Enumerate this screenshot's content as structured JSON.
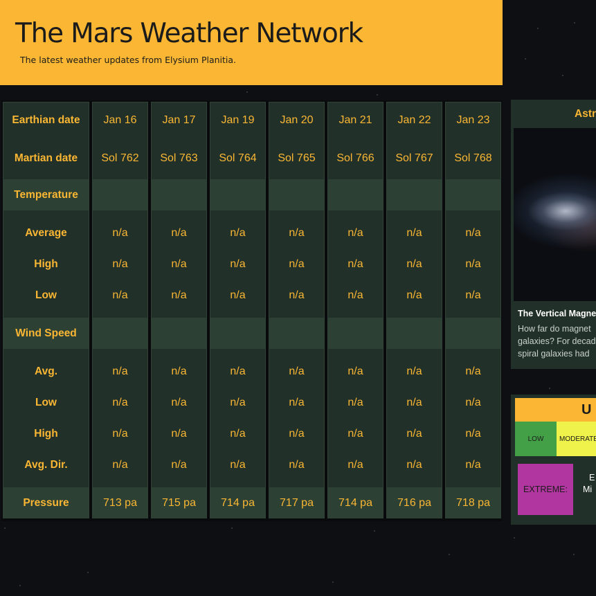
{
  "header": {
    "title": "The Mars Weather Network",
    "subtitle": "The latest weather updates from Elysium Planitia."
  },
  "weather": {
    "row_labels": {
      "earth_date": "Earthian date",
      "mars_date": "Martian date",
      "temperature": "Temperature",
      "temp_avg": "Average",
      "temp_high": "High",
      "temp_low": "Low",
      "wind_speed": "Wind Speed",
      "wind_avg": "Avg.",
      "wind_low": "Low",
      "wind_high": "High",
      "wind_dir": "Avg. Dir.",
      "pressure": "Pressure"
    },
    "days": [
      {
        "earth_date": "Jan 16",
        "mars_date": "Sol 762",
        "temp_avg": "n/a",
        "temp_high": "n/a",
        "temp_low": "n/a",
        "wind_avg": "n/a",
        "wind_low": "n/a",
        "wind_high": "n/a",
        "wind_dir": "n/a",
        "pressure": "713 pa"
      },
      {
        "earth_date": "Jan 17",
        "mars_date": "Sol 763",
        "temp_avg": "n/a",
        "temp_high": "n/a",
        "temp_low": "n/a",
        "wind_avg": "n/a",
        "wind_low": "n/a",
        "wind_high": "n/a",
        "wind_dir": "n/a",
        "pressure": "715 pa"
      },
      {
        "earth_date": "Jan 19",
        "mars_date": "Sol 764",
        "temp_avg": "n/a",
        "temp_high": "n/a",
        "temp_low": "n/a",
        "wind_avg": "n/a",
        "wind_low": "n/a",
        "wind_high": "n/a",
        "wind_dir": "n/a",
        "pressure": "714 pa"
      },
      {
        "earth_date": "Jan 20",
        "mars_date": "Sol 765",
        "temp_avg": "n/a",
        "temp_high": "n/a",
        "temp_low": "n/a",
        "wind_avg": "n/a",
        "wind_low": "n/a",
        "wind_high": "n/a",
        "wind_dir": "n/a",
        "pressure": "717 pa"
      },
      {
        "earth_date": "Jan 21",
        "mars_date": "Sol 766",
        "temp_avg": "n/a",
        "temp_high": "n/a",
        "temp_low": "n/a",
        "wind_avg": "n/a",
        "wind_low": "n/a",
        "wind_high": "n/a",
        "wind_dir": "n/a",
        "pressure": "714 pa"
      },
      {
        "earth_date": "Jan 22",
        "mars_date": "Sol 767",
        "temp_avg": "n/a",
        "temp_high": "n/a",
        "temp_low": "n/a",
        "wind_avg": "n/a",
        "wind_low": "n/a",
        "wind_high": "n/a",
        "wind_dir": "n/a",
        "pressure": "716 pa"
      },
      {
        "earth_date": "Jan 23",
        "mars_date": "Sol 768",
        "temp_avg": "n/a",
        "temp_high": "n/a",
        "temp_low": "n/a",
        "wind_avg": "n/a",
        "wind_low": "n/a",
        "wind_high": "n/a",
        "wind_dir": "n/a",
        "pressure": "718 pa"
      }
    ]
  },
  "apod": {
    "title": "Astro",
    "image_name": "galaxy-image",
    "caption": "The Vertical Magne",
    "text_lines": [
      "How far do magnet",
      "galaxies? For decad",
      "spiral galaxies had"
    ]
  },
  "uv": {
    "header": "U V",
    "low": "LOW",
    "moderate": "MODERATE",
    "extreme": "EXTREME:",
    "extreme_text_lines": [
      "E",
      "Mi"
    ]
  },
  "colors": {
    "accent": "#fbb733",
    "panel": "#213029",
    "panel_highlight": "#2c4034",
    "background": "#0e0f12",
    "uv_low": "#43a047",
    "uv_moderate": "#eef24a",
    "uv_extreme": "#b236a0"
  }
}
